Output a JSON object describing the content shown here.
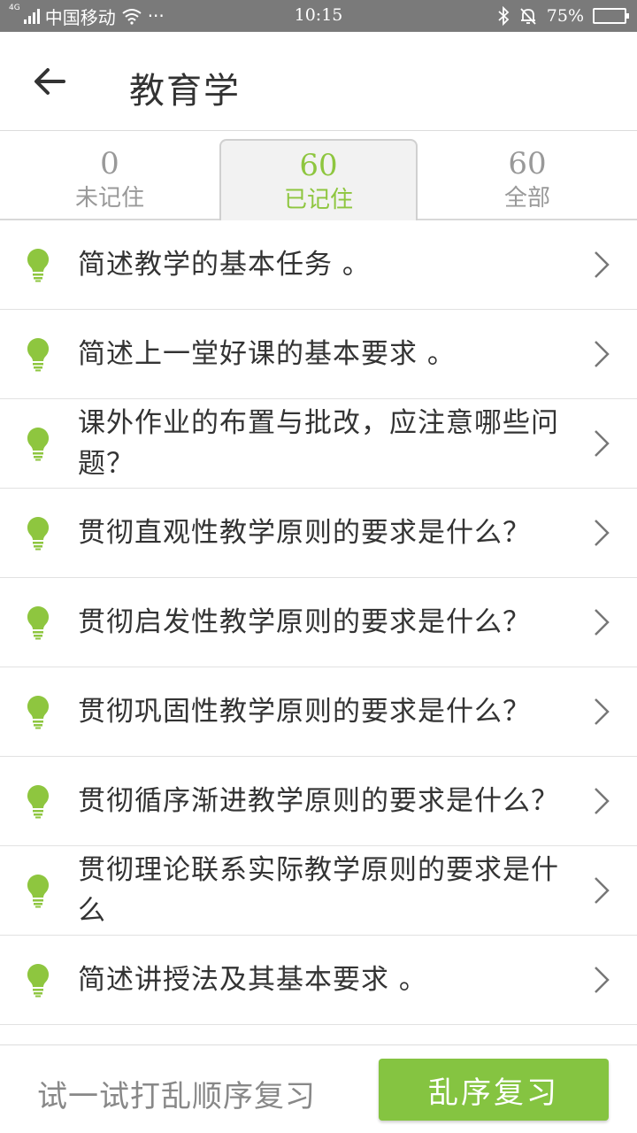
{
  "status_bar": {
    "network": "4G",
    "carrier": "中国移动",
    "dots": "···",
    "time": "10:15",
    "battery": "75%",
    "battery_level": 0.75
  },
  "header": {
    "title": "教育学"
  },
  "tabs": [
    {
      "count": "0",
      "label": "未记住",
      "active": false
    },
    {
      "count": "60",
      "label": "已记住",
      "active": true
    },
    {
      "count": "60",
      "label": "全部",
      "active": false
    }
  ],
  "questions": [
    "简述教学的基本任务 。",
    "简述上一堂好课的基本要求 。",
    "课外作业的布置与批改，应注意哪些问题？",
    "贯彻直观性教学原则的要求是什么？",
    "贯彻启发性教学原则的要求是什么？",
    "贯彻巩固性教学原则的要求是什么？",
    "贯彻循序渐进教学原则的要求是什么？",
    "贯彻理论联系实际教学原则的要求是什么",
    "简述讲授法及其基本要求 。"
  ],
  "bottom": {
    "hint": "试一试打乱顺序复习",
    "button": "乱序复习"
  },
  "colors": {
    "accent": "#85c441",
    "status_bar": "#7a7a7a"
  }
}
